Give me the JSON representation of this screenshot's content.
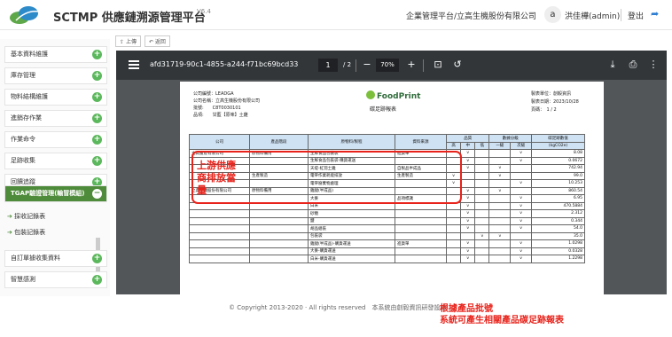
{
  "header": {
    "app_title": "SCTMP 供應鏈溯源管理平台",
    "version": "V6.4",
    "company": "企業管理平台/立高生機股份有限公司",
    "avatar_letter": "a",
    "user": "洪佳樺(admin)",
    "logout": "登出"
  },
  "sidebar": {
    "items": [
      {
        "label": "基本資料維護"
      },
      {
        "label": "庫存管理"
      },
      {
        "label": "物料結構維護"
      },
      {
        "label": "進銷存作業"
      },
      {
        "label": "作業命令"
      },
      {
        "label": "足跡收集"
      },
      {
        "label": "回饋追蹤"
      },
      {
        "label": "TGAP驗證管理(輸冒模組)"
      },
      {
        "label": "自訂單據收集資料"
      },
      {
        "label": "智慧感測"
      }
    ],
    "subitems": [
      {
        "label": "採收記錄表"
      },
      {
        "label": "包裝記錄表"
      }
    ]
  },
  "breadcrumb": {
    "up": "上傳",
    "back": "返回"
  },
  "viewer": {
    "filename": "afd31719-90c1-4855-a244-f71bc69bcd33",
    "page_current": "1",
    "page_total": "/ 2",
    "zoom": "70%"
  },
  "report": {
    "company_code": "公司編號：LEADGA",
    "company_name": "公司名稱：立高生機股份有限公司",
    "batch": "批號:　　C8T0030101",
    "product": "品項:　　甘藍【原味】土雞",
    "maker": "製表單位：創毅資訊",
    "date": "製表日期：2023/10/28",
    "page": "頁碼：　1 / 2",
    "brand": "FoodPrint",
    "title": "碳足跡報表",
    "headers": [
      "公司",
      "產品階段",
      "原物料/製程",
      "資料來源",
      "品質",
      "數據分級",
      "碳足跡數值"
    ],
    "subheaders": [
      "高",
      "中",
      "低",
      "一級",
      "次級"
    ],
    "unit": "(kgCO2e)",
    "rows": [
      {
        "company": "立高畜產有限公司",
        "stage": "原物料備用",
        "material": "生鮮食品包裝袋",
        "source": "進貨單",
        "value": "8.08"
      },
      {
        "company": "",
        "stage": "",
        "material": "生鮮食品包裝袋-購貨運送",
        "source": "",
        "value": "0.0672"
      },
      {
        "company": "",
        "stage": "",
        "material": "天堤-紅羽土雞",
        "source": "自製品半成品",
        "value": "742.94"
      },
      {
        "company": "",
        "stage": "生產製造",
        "material": "電宰作業耗能排放",
        "source": "生產製造",
        "value": "99.0"
      },
      {
        "company": "",
        "stage": "",
        "material": "電宰廢棄物處理",
        "source": "",
        "value": "10.253"
      },
      {
        "company": "立高生機股份有限公司",
        "stage": "原物料備用",
        "material": "雞腿(半成品)",
        "source": "",
        "value": "860.54"
      },
      {
        "company": "",
        "stage": "",
        "material": "大麥",
        "source": "品項標識",
        "value": "6.95"
      },
      {
        "company": "",
        "stage": "",
        "material": "白米",
        "source": "",
        "value": "470.5884"
      },
      {
        "company": "",
        "stage": "",
        "material": "砂糖",
        "source": "",
        "value": "2.312"
      },
      {
        "company": "",
        "stage": "",
        "material": "鹽",
        "source": "",
        "value": "0.344"
      },
      {
        "company": "",
        "stage": "",
        "material": "胡品組裝",
        "source": "",
        "value": "54.0"
      },
      {
        "company": "",
        "stage": "",
        "material": "包裝袋",
        "source": "",
        "value": "35.0"
      },
      {
        "company": "",
        "stage": "",
        "material": "雞腿(半成品)-購貨運送",
        "source": "進貨單",
        "value": "1.0298"
      },
      {
        "company": "",
        "stage": "",
        "material": "大麥-購貨運送",
        "source": "",
        "value": "0.0328"
      },
      {
        "company": "",
        "stage": "",
        "material": "白米-購貨運送",
        "source": "",
        "value": "1.2298"
      }
    ]
  },
  "annotation": {
    "box_label": "上游供應商排放當量",
    "callout_line1": "根據產品批號",
    "callout_line2": "系統可產生相關產品碳足跡報表"
  },
  "footer": {
    "text": "© Copyright 2013-2020 · All rights reserved　本系統由創毅資訊研發設計"
  }
}
